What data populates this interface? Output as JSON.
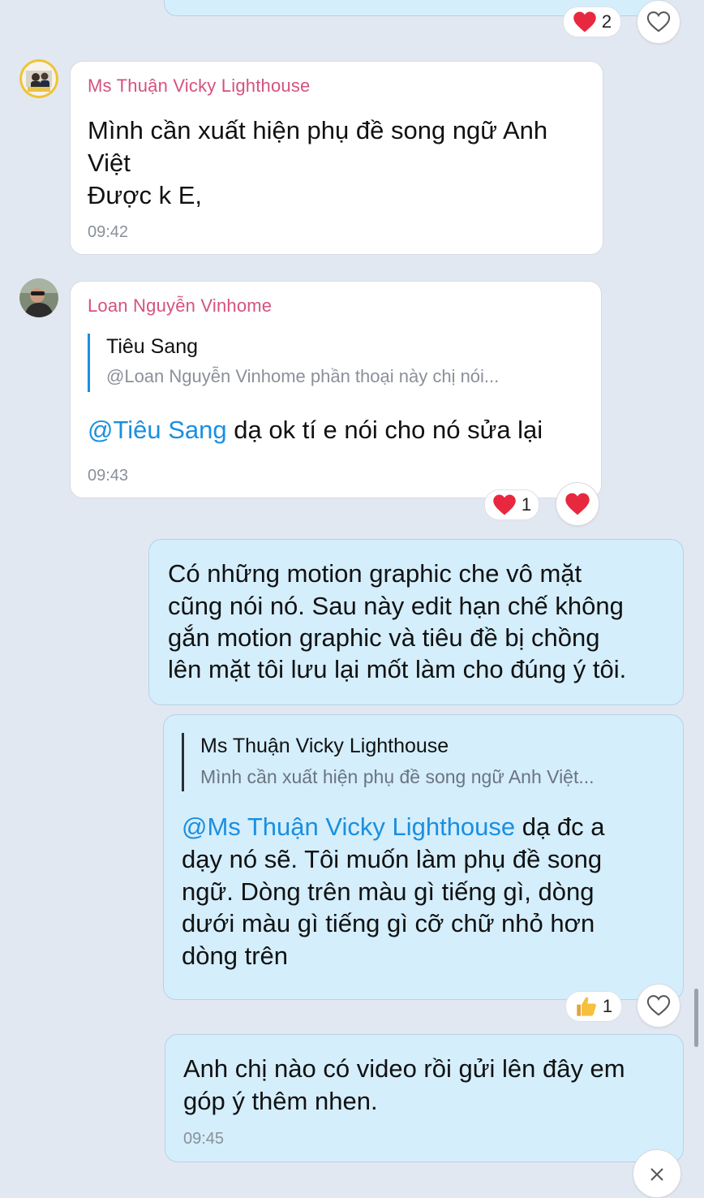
{
  "messages": [
    {
      "sender": "Ms Thuận Vicky Lighthouse",
      "lines": [
        "Mình cần xuất hiện phụ đề song ngữ Anh",
        "Việt",
        "Được k E,"
      ],
      "time": "09:42"
    },
    {
      "sender": "Loan Nguyễn Vinhome",
      "quote_title": "Tiêu Sang",
      "quote_text": "@Loan Nguyễn Vinhome phần thoại này chị nói...",
      "mention": "@Tiêu Sang",
      "text": " dạ ok tí e nói cho nó sửa lại",
      "time": "09:43"
    },
    {
      "lines": [
        "Có những motion graphic che vô mặt",
        "cũng nói nó. Sau này edit hạn chế không",
        "gắn motion graphic và tiêu đề bị chồng",
        "lên mặt tôi lưu lại mốt làm cho đúng ý tôi."
      ]
    },
    {
      "quote_title": "Ms Thuận Vicky Lighthouse",
      "quote_text": "Mình cần xuất hiện phụ đề song ngữ Anh Việt...",
      "mention": "@Ms Thuận Vicky Lighthouse",
      "line1_rest": " dạ đc a",
      "lines": [
        "dạy nó sẽ. Tôi muốn làm phụ đề song",
        "ngữ. Dòng trên màu gì tiếng gì, dòng",
        "dưới màu gì tiếng gì cỡ chữ nhỏ hơn",
        "dòng trên"
      ]
    },
    {
      "lines": [
        "Anh chị nào có video rồi gửi lên đây em",
        "góp ý thêm nhen."
      ],
      "time": "09:45"
    }
  ],
  "reactions": {
    "top_heart_count": "2",
    "loan_heart_count": "1",
    "reply_thumb_count": "1"
  },
  "icons": {
    "heart_outline": "heart-outline-icon",
    "heart_filled": "heart-icon",
    "thumbs_up": "thumbs-up-icon",
    "close": "close-icon"
  },
  "colors": {
    "background": "#e2e8f1",
    "incoming_bubble": "#ffffff",
    "outgoing_bubble": "#d4eefc",
    "sender_name": "#d5527e",
    "mention": "#1a8fe0",
    "heart": "#e8283f"
  }
}
